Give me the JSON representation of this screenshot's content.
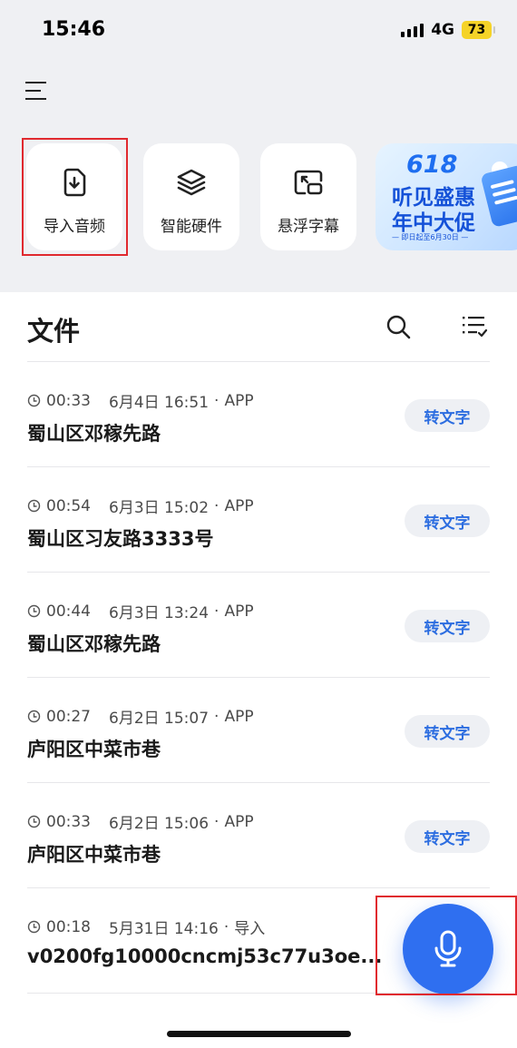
{
  "status_bar": {
    "time": "15:46",
    "network": "4G",
    "battery": "73"
  },
  "quick_actions": [
    {
      "label": "导入音频",
      "icon": "import-audio-icon"
    },
    {
      "label": "智能硬件",
      "icon": "layers-icon"
    },
    {
      "label": "悬浮字幕",
      "icon": "floating-subtitle-icon"
    }
  ],
  "promo": {
    "badge": "618",
    "line1": "听见盛惠",
    "line2": "年中大促",
    "subtitle": "— 即日起至6月30日 —"
  },
  "files": {
    "title": "文件",
    "convert_label": "转文字",
    "items": [
      {
        "duration": "00:33",
        "datetime": "6月4日 16:51",
        "source": "APP",
        "name": "蜀山区邓稼先路"
      },
      {
        "duration": "00:54",
        "datetime": "6月3日 15:02",
        "source": "APP",
        "name": "蜀山区习友路3333号"
      },
      {
        "duration": "00:44",
        "datetime": "6月3日 13:24",
        "source": "APP",
        "name": "蜀山区邓稼先路"
      },
      {
        "duration": "00:27",
        "datetime": "6月2日 15:07",
        "source": "APP",
        "name": "庐阳区中菜市巷"
      },
      {
        "duration": "00:33",
        "datetime": "6月2日 15:06",
        "source": "APP",
        "name": "庐阳区中菜市巷"
      },
      {
        "duration": "00:18",
        "datetime": "5月31日 14:16",
        "source": "导入",
        "name": "v0200fg10000cncmj53c77u3oe..."
      }
    ]
  },
  "colors": {
    "accent": "#2f6ff0",
    "highlight": "#e0292e",
    "background": "#eff0f3"
  }
}
